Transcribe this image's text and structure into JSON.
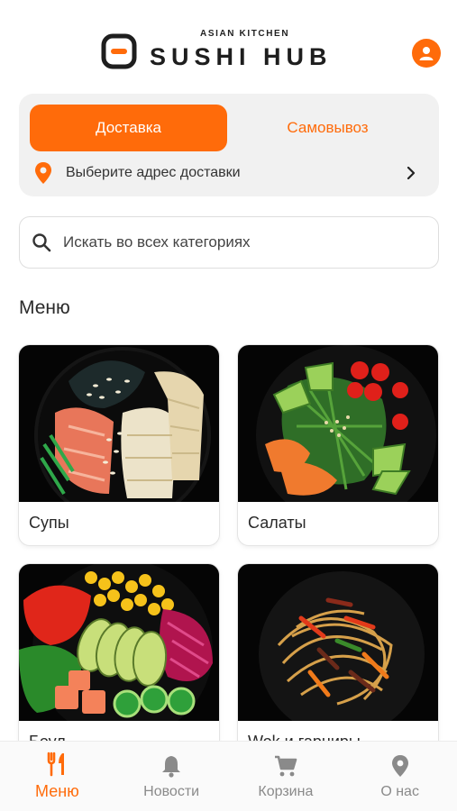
{
  "brand": {
    "tagline": "ASIAN KITCHEN",
    "name": "SUSHI HUB"
  },
  "colors": {
    "accent": "#ff6b0a",
    "inactive_nav": "#8a8a8a"
  },
  "delivery": {
    "tabs": [
      {
        "label": "Доставка",
        "active": true
      },
      {
        "label": "Самовывоз",
        "active": false
      }
    ],
    "address_prompt": "Выберите адрес доставки"
  },
  "search": {
    "placeholder": "Искать во всех категориях"
  },
  "menu": {
    "title": "Меню",
    "categories": [
      {
        "label": "Супы"
      },
      {
        "label": "Салаты"
      },
      {
        "label": "Боул"
      },
      {
        "label": "Wok и гарниры"
      }
    ]
  },
  "nav": {
    "items": [
      {
        "label": "Меню",
        "icon": "fork-knife-icon",
        "active": true
      },
      {
        "label": "Новости",
        "icon": "bell-icon",
        "active": false
      },
      {
        "label": "Корзина",
        "icon": "cart-icon",
        "active": false
      },
      {
        "label": "О нас",
        "icon": "location-pin-icon",
        "active": false
      }
    ]
  }
}
